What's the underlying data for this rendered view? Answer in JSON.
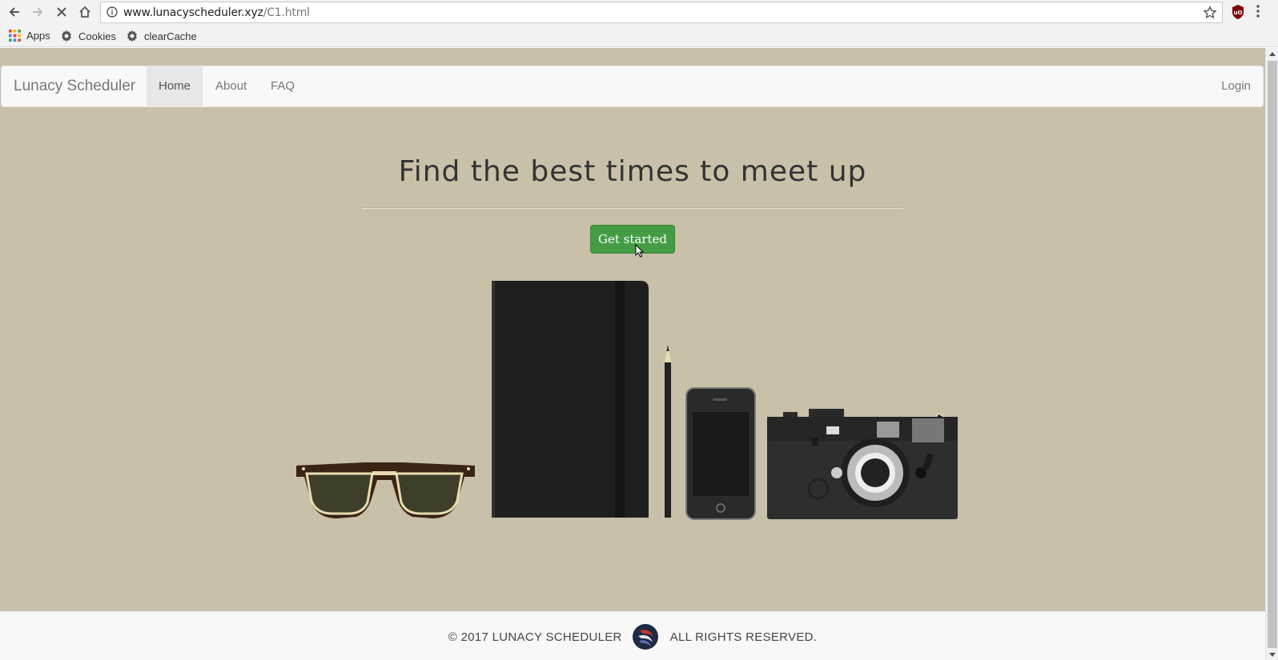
{
  "browser": {
    "url_host": "www.lunacyscheduler.xyz",
    "url_path": "/C1.html",
    "bookmarks": [
      {
        "label": "Apps",
        "icon": "apps-grid-icon"
      },
      {
        "label": "Cookies",
        "icon": "gear-icon"
      },
      {
        "label": "clearCache",
        "icon": "gear-icon"
      }
    ]
  },
  "navbar": {
    "brand": "Lunacy Scheduler",
    "items": [
      {
        "label": "Home",
        "active": true
      },
      {
        "label": "About",
        "active": false
      },
      {
        "label": "FAQ",
        "active": false
      }
    ],
    "login": "Login"
  },
  "hero": {
    "headline": "Find the best times to meet up",
    "cta_label": "Get started",
    "cta_color": "#449d44",
    "illustration_items": [
      "sunglasses",
      "notebook",
      "pencil",
      "phone",
      "camera"
    ]
  },
  "footer": {
    "copyright": "© 2017 LUNACY SCHEDULER",
    "rights": "ALL RIGHTS RESERVED."
  },
  "colors": {
    "page_background": "#c8c0a8",
    "navbar_background": "#f8f8f8"
  }
}
